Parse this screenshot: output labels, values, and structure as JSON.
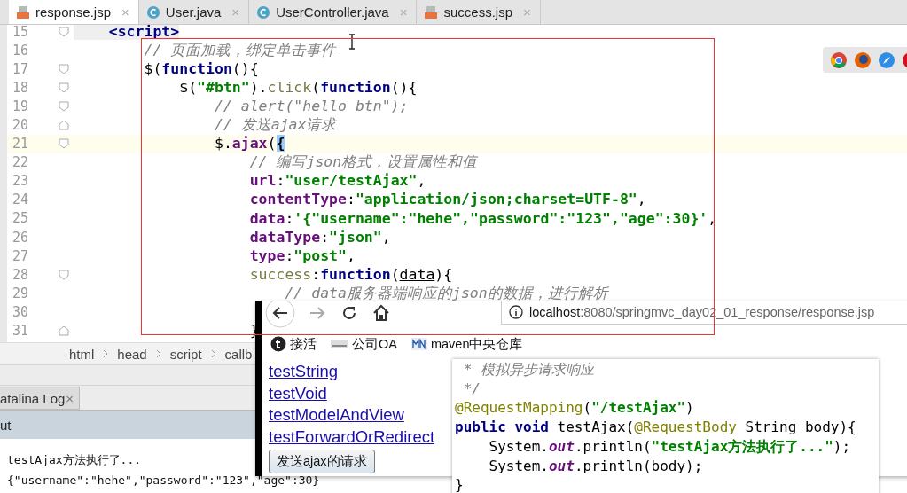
{
  "tabs": [
    {
      "label": "response.jsp",
      "kind": "jsp",
      "close": "×",
      "selected": true
    },
    {
      "label": "User.java",
      "kind": "class",
      "close": "×",
      "selected": false
    },
    {
      "label": "UserController.java",
      "kind": "class",
      "close": "×",
      "selected": false
    },
    {
      "label": "success.jsp",
      "kind": "jsp",
      "close": "×",
      "selected": false
    }
  ],
  "editor": {
    "lines": [
      {
        "number": "15",
        "kind": "opener",
        "current": false,
        "tokens": [
          {
            "t": "    <script>",
            "kind": "tag"
          }
        ]
      },
      {
        "number": "16",
        "kind": "plain",
        "current": false,
        "tokens": [
          {
            "t": "        // 页面加载，绑定单击事件",
            "kind": "cmt"
          }
        ]
      },
      {
        "number": "17",
        "kind": "opener",
        "current": false,
        "tokens": [
          {
            "t": "        $(",
            "kind": "plain"
          },
          {
            "t": "function",
            "kind": "kw"
          },
          {
            "t": "(){",
            "kind": "plain"
          }
        ]
      },
      {
        "number": "18",
        "kind": "opener",
        "current": false,
        "tokens": [
          {
            "t": "            $(",
            "kind": "plain"
          },
          {
            "t": "\"#btn\"",
            "kind": "str"
          },
          {
            "t": ").",
            "kind": "plain"
          },
          {
            "t": "click",
            "kind": "fn"
          },
          {
            "t": "(",
            "kind": "plain"
          },
          {
            "t": "function",
            "kind": "kw"
          },
          {
            "t": "(){",
            "kind": "plain"
          }
        ]
      },
      {
        "number": "19",
        "kind": "opener",
        "current": false,
        "tokens": [
          {
            "t": "                // alert(\"hello btn\");",
            "kind": "cmt"
          }
        ]
      },
      {
        "number": "20",
        "kind": "closer",
        "current": false,
        "tokens": [
          {
            "t": "                // 发送ajax请求",
            "kind": "cmt"
          }
        ]
      },
      {
        "number": "21",
        "kind": "opener",
        "current": true,
        "tokens": [
          {
            "t": "                $.",
            "kind": "plain"
          },
          {
            "t": "ajax",
            "kind": "prop"
          },
          {
            "t": "(",
            "kind": "plain"
          },
          {
            "t": "{",
            "kind": "match"
          }
        ]
      },
      {
        "number": "22",
        "kind": "plain",
        "current": false,
        "tokens": [
          {
            "t": "                    // 编写json格式，设置属性和值",
            "kind": "cmt"
          }
        ]
      },
      {
        "number": "23",
        "kind": "plain",
        "current": false,
        "tokens": [
          {
            "t": "                    url",
            "kind": "prop"
          },
          {
            "t": ":",
            "kind": "plain"
          },
          {
            "t": "\"user/testAjax\"",
            "kind": "str"
          },
          {
            "t": ",",
            "kind": "plain"
          }
        ]
      },
      {
        "number": "24",
        "kind": "plain",
        "current": false,
        "tokens": [
          {
            "t": "                    contentType",
            "kind": "prop"
          },
          {
            "t": ":",
            "kind": "plain"
          },
          {
            "t": "\"application/json;charset=UTF-8\"",
            "kind": "str"
          },
          {
            "t": ",",
            "kind": "plain"
          }
        ]
      },
      {
        "number": "25",
        "kind": "plain",
        "current": false,
        "tokens": [
          {
            "t": "                    data",
            "kind": "prop"
          },
          {
            "t": ":",
            "kind": "plain"
          },
          {
            "t": "'{\"username\":\"hehe\",\"password\":\"123\",\"age\":30}'",
            "kind": "str"
          },
          {
            "t": ",",
            "kind": "plain"
          }
        ]
      },
      {
        "number": "26",
        "kind": "plain",
        "current": false,
        "tokens": [
          {
            "t": "                    dataType",
            "kind": "prop"
          },
          {
            "t": ":",
            "kind": "plain"
          },
          {
            "t": "\"json\"",
            "kind": "str"
          },
          {
            "t": ",",
            "kind": "plain"
          }
        ]
      },
      {
        "number": "27",
        "kind": "plain",
        "current": false,
        "tokens": [
          {
            "t": "                    type",
            "kind": "prop"
          },
          {
            "t": ":",
            "kind": "plain"
          },
          {
            "t": "\"post\"",
            "kind": "str"
          },
          {
            "t": ",",
            "kind": "plain"
          }
        ]
      },
      {
        "number": "28",
        "kind": "opener",
        "current": false,
        "tokens": [
          {
            "t": "                    success",
            "kind": "fn"
          },
          {
            "t": ":",
            "kind": "plain"
          },
          {
            "t": "function",
            "kind": "kw"
          },
          {
            "t": "(",
            "kind": "plain"
          },
          {
            "t": "data",
            "kind": "under"
          },
          {
            "t": "){",
            "kind": "plain"
          }
        ]
      },
      {
        "number": "29",
        "kind": "plain",
        "current": false,
        "tokens": [
          {
            "t": "                        // data服务器端响应的json的数据，进行解析",
            "kind": "cmt"
          }
        ]
      },
      {
        "number": "30",
        "kind": "plain",
        "current": false
      },
      {
        "number": "31",
        "kind": "closer",
        "current": false,
        "tokens": [
          {
            "t": "                    }",
            "kind": "plain"
          }
        ]
      }
    ]
  },
  "breadcrumbs": [
    "html",
    "head",
    "script",
    "callb"
  ],
  "bottom_panel": {
    "tab": {
      "label": "atalina Log",
      "close": "×"
    },
    "header": "ut",
    "output": [
      "testAjax方法执行了...",
      "{\"username\":\"hehe\",\"password\":\"123\",\"age\":30}"
    ]
  },
  "browser": {
    "url": {
      "host": "localhost",
      "rest": ":8080/springmvc_day02_01_response/response.jsp"
    },
    "bookmarks": [
      "接活",
      "公司OA",
      "maven中央仓库"
    ],
    "links": [
      "testString",
      "testVoid",
      "testModelAndView",
      "testForwardOrRedirect"
    ],
    "button": "发送ajax的请求"
  },
  "popup": {
    "lines": [
      [
        {
          "t": " * 模拟异步请求响应",
          "kind": "cmt"
        }
      ],
      [
        {
          "t": " */",
          "kind": "cmt"
        }
      ],
      [
        {
          "t": "@RequestMapping",
          "kind": "ann"
        },
        {
          "t": "(",
          "kind": "plain"
        },
        {
          "t": "\"/testAjax\"",
          "kind": "str"
        },
        {
          "t": ")",
          "kind": "plain"
        }
      ],
      [
        {
          "t": "public void ",
          "kind": "kw"
        },
        {
          "t": "testAjax(",
          "kind": "plain"
        },
        {
          "t": "@RequestBody",
          "kind": "ann"
        },
        {
          "t": " String body){",
          "kind": "plain"
        }
      ],
      [
        {
          "t": "    System.",
          "kind": "plain"
        },
        {
          "t": "out",
          "kind": "field"
        },
        {
          "t": ".println(",
          "kind": "plain"
        },
        {
          "t": "\"testAjax方法执行了...\"",
          "kind": "str"
        },
        {
          "t": ");",
          "kind": "plain"
        }
      ],
      [
        {
          "t": "    System.",
          "kind": "plain"
        },
        {
          "t": "out",
          "kind": "field"
        },
        {
          "t": ".println(body);",
          "kind": "plain"
        }
      ],
      [
        {
          "t": "}",
          "kind": "plain"
        }
      ]
    ]
  }
}
